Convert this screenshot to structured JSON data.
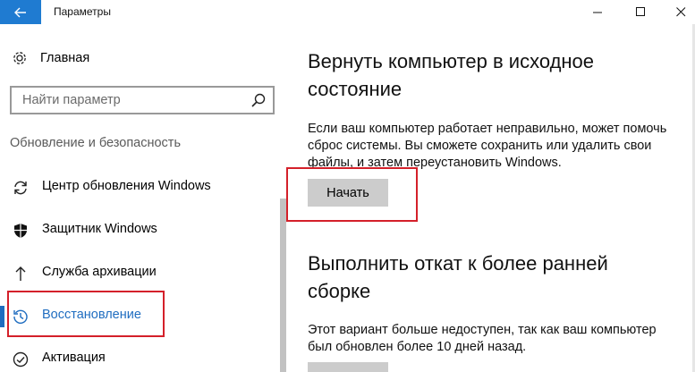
{
  "window": {
    "title": "Параметры",
    "back_icon": "arrow-left-icon",
    "accent_color": "#1f7bd1"
  },
  "sidebar": {
    "home_label": "Главная",
    "search_placeholder": "Найти параметр",
    "section_header": "Обновление и безопасность",
    "items": [
      {
        "label": "Центр обновления Windows",
        "icon": "sync-icon"
      },
      {
        "label": "Защитник Windows",
        "icon": "shield-icon"
      },
      {
        "label": "Служба архивации",
        "icon": "upload-arrow-icon"
      },
      {
        "label": "Восстановление",
        "icon": "history-icon",
        "active": true
      },
      {
        "label": "Активация",
        "icon": "check-circle-icon"
      }
    ]
  },
  "main": {
    "reset": {
      "title": "Вернуть компьютер в исходное состояние",
      "title_line1": "Вернуть компьютер в исходное",
      "title_line2": "состояние",
      "desc_line1": "Если ваш компьютер работает неправильно, может помочь",
      "desc_line2": "сброс системы. Вы сможете сохранить или удалить свои",
      "desc_line3": "файлы, и затем переустановить Windows.",
      "button_label": "Начать"
    },
    "rollback": {
      "title_line1": "Выполнить откат к более ранней",
      "title_line2": "сборке",
      "desc_line1": "Этот вариант больше недоступен, так как ваш компьютер",
      "desc_line2": "был обновлен более 10 дней назад."
    }
  },
  "highlight_color": "#d4202a"
}
